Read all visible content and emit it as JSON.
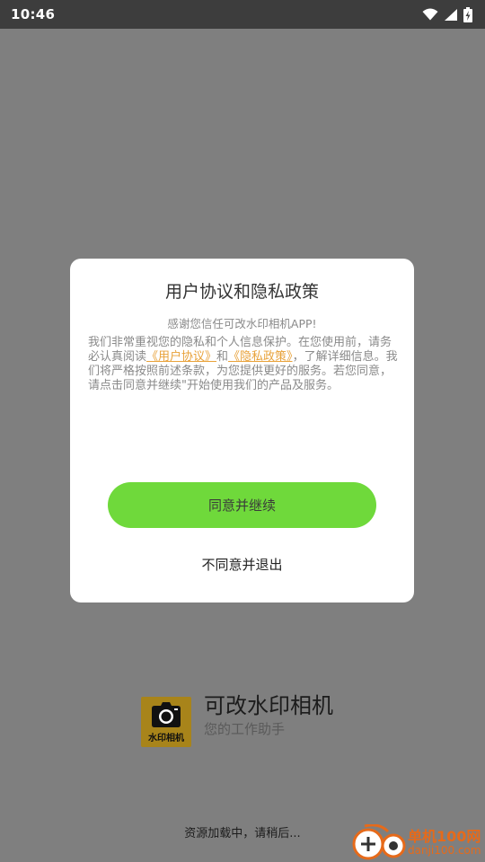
{
  "status_bar": {
    "time": "10:46"
  },
  "dialog": {
    "title": "用户协议和隐私政策",
    "subtitle": "感谢您信任可改水印相机APP!",
    "body": {
      "part1": "我们非常重视您的隐私和个人信息保护。在您使用前，请务必认真阅读",
      "link_user_agreement": "《用户协议》",
      "part2": "和",
      "link_privacy_policy": "《隐私政策》",
      "part3": "，了解详细信息。我们将严格按照前述条款，为您提供更好的服务。若您同意，请点击同意并继续\"开始使用我们的产品及服务。"
    },
    "agree_label": "同意并继续",
    "disagree_label": "不同意并退出"
  },
  "splash": {
    "logo_text": "水印相机",
    "app_name": "可改水印相机",
    "slogan": "您的工作助手",
    "loading": "资源加载中，请稍后..."
  },
  "watermark": {
    "name": "单机100网",
    "domain": "danji100.com"
  },
  "colors": {
    "overlay": "#7f7f7f",
    "status_bar": "#3d3d3d",
    "accent_green": "#6fd93b",
    "link_orange": "#e8a23a",
    "logo_gold": "#a8841a"
  },
  "icons": [
    "wifi-icon",
    "signal-icon",
    "battery-charging-icon",
    "camera-icon"
  ]
}
